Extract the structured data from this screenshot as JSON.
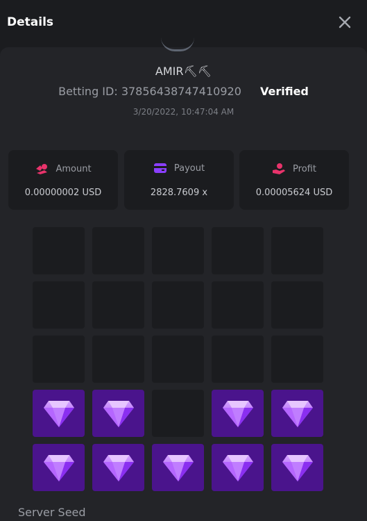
{
  "header": {
    "title": "Details",
    "close_icon": "close-icon"
  },
  "bet": {
    "username": "AMIR⛏⛏",
    "betting_id": "Betting ID: 37856438747410920",
    "verified": "Verified",
    "timestamp": "3/20/2022, 10:47:04 AM"
  },
  "stats": [
    {
      "label": "Amount",
      "value": "0.00000002 USD",
      "icon": "coins-icon",
      "color": "#e8336b"
    },
    {
      "label": "Payout",
      "value": "2828.7609 x",
      "icon": "wallet-icon",
      "color": "#8b3ffd"
    },
    {
      "label": "Profit",
      "value": "0.00005624 USD",
      "icon": "hand-coin-icon",
      "color": "#e8336b"
    }
  ],
  "board": {
    "columns": 5,
    "rows": 5,
    "tiles": [
      "empty",
      "empty",
      "empty",
      "empty",
      "empty",
      "empty",
      "empty",
      "empty",
      "empty",
      "empty",
      "empty",
      "empty",
      "empty",
      "empty",
      "empty",
      "gem",
      "gem",
      "empty",
      "gem",
      "gem",
      "gem",
      "gem",
      "gem",
      "gem",
      "gem"
    ],
    "gem_color": "#a855f7",
    "tile_gem_bg": "#4a148c"
  },
  "server_seed_label": "Server Seed"
}
